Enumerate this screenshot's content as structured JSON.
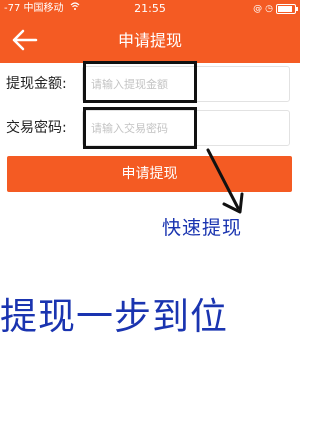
{
  "status_bar": {
    "signal": "-77",
    "carrier": "中国移动",
    "time": "21:55",
    "icons": [
      "wifi-icon",
      "at-icon",
      "clock-icon",
      "battery-icon"
    ]
  },
  "nav": {
    "title": "申请提现",
    "back_icon": "back-arrow-icon"
  },
  "form": {
    "amount": {
      "label": "提现金额:",
      "placeholder": "请输入提现金额",
      "value": ""
    },
    "password": {
      "label": "交易密码:",
      "placeholder": "请输入交易密码",
      "value": ""
    },
    "submit_label": "申请提现"
  },
  "annotations": {
    "small": "快速提现",
    "large": "提现一步到位"
  },
  "colors": {
    "accent": "#f45b23",
    "annotation": "#1a34b0"
  }
}
